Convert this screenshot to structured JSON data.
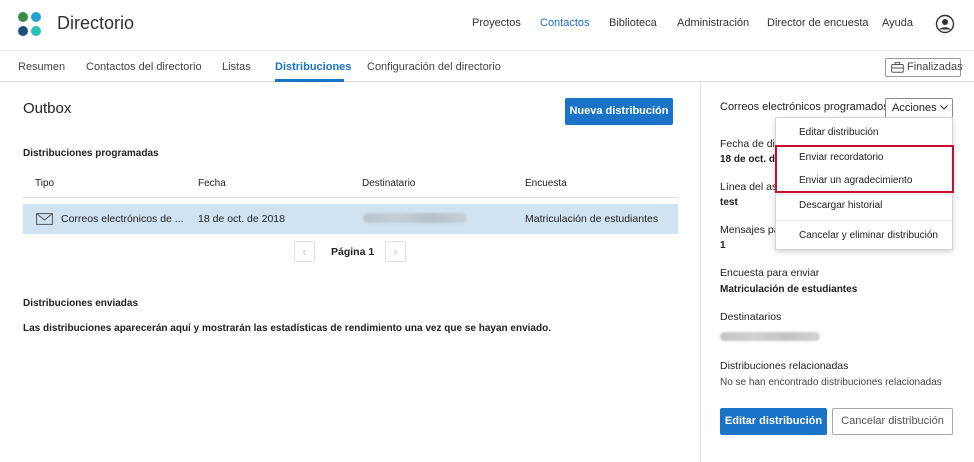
{
  "colors": {
    "accent": "#1a73c7",
    "highlight": "#c8102e",
    "selected_row": "#cfe3f2"
  },
  "header": {
    "title": "Directorio",
    "nav": [
      "Proyectos",
      "Contactos",
      "Biblioteca",
      "Administración",
      "Director de encuesta",
      "Ayuda"
    ],
    "active_nav": "Contactos"
  },
  "subnav": {
    "tabs": [
      "Resumen",
      "Contactos del directorio",
      "Listas",
      "Distribuciones",
      "Configuración del directorio"
    ],
    "active_tab": "Distribuciones",
    "finalizadas_label": "Finalizadas"
  },
  "main": {
    "title": "Outbox",
    "new_button": "Nueva distribución",
    "scheduled": {
      "label": "Distribuciones programadas",
      "columns": [
        "Tipo",
        "Fecha",
        "Destinatario",
        "Encuesta"
      ],
      "rows": [
        {
          "type": "Correos electrónicos de ...",
          "date": "18 de oct. de 2018",
          "recipient": "",
          "survey": "Matriculación de estudiantes"
        }
      ],
      "page_label": "Página 1"
    },
    "sent": {
      "label": "Distribuciones enviadas",
      "empty_message": "Las distribuciones aparecerán aquí y mostrarán las estadísticas de rendimiento una vez que se hayan enviado."
    }
  },
  "side": {
    "title": "Correos electrónicos programados",
    "actions_label": "Acciones",
    "fields": [
      {
        "label": "Fecha de dist",
        "value": "18 de oct. de"
      },
      {
        "label": "Línea del asu",
        "value": "test"
      },
      {
        "label": "Mensajes par",
        "value": "1"
      },
      {
        "label": "Encuesta para enviar",
        "value": "Matriculación de estudiantes"
      },
      {
        "label": "Destinatarios",
        "value": ""
      },
      {
        "label": "Distribuciones relacionadas",
        "value": "No se han encontrado distribuciones relacionadas"
      }
    ],
    "edit_button": "Editar distribución",
    "cancel_button": "Cancelar distribución"
  },
  "menu": {
    "items": [
      "Editar distribución",
      "Enviar recordatorio",
      "Enviar un agradecimiento",
      "Descargar historial",
      "Cancelar y eliminar distribución"
    ]
  }
}
